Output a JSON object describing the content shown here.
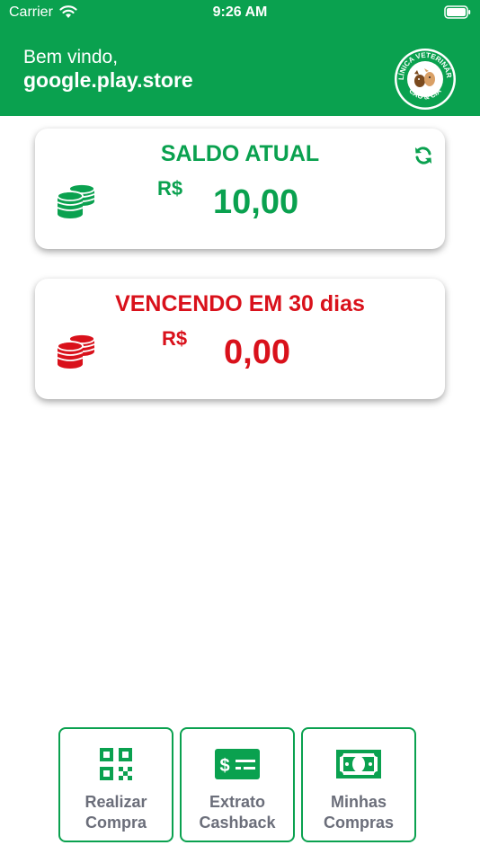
{
  "status_bar": {
    "carrier": "Carrier",
    "time": "9:26 AM"
  },
  "header": {
    "greeting": "Bem vindo,",
    "username": "google.play.store",
    "logo_text_top": "CLÍNICA VETERINÁRIA",
    "logo_text_bottom": "CÃO & CIA"
  },
  "cards": {
    "saldo": {
      "title": "SALDO ATUAL",
      "currency": "R$",
      "amount": "10,00",
      "color": "#0aa14f"
    },
    "vencendo": {
      "title": "VENCENDO EM 30 dias",
      "currency": "R$",
      "amount": "0,00",
      "color": "#d9111b"
    }
  },
  "nav": {
    "realizar": {
      "line1": "Realizar",
      "line2": "Compra",
      "icon": "qr-code-icon"
    },
    "extrato": {
      "line1": "Extrato",
      "line2": "Cashback",
      "icon": "money-check-icon"
    },
    "minhas": {
      "line1": "Minhas",
      "line2": "Compras",
      "icon": "banknote-icon"
    }
  },
  "colors": {
    "brand_green": "#0aa14f",
    "alert_red": "#d9111b",
    "label_gray": "#6b6e7a"
  }
}
